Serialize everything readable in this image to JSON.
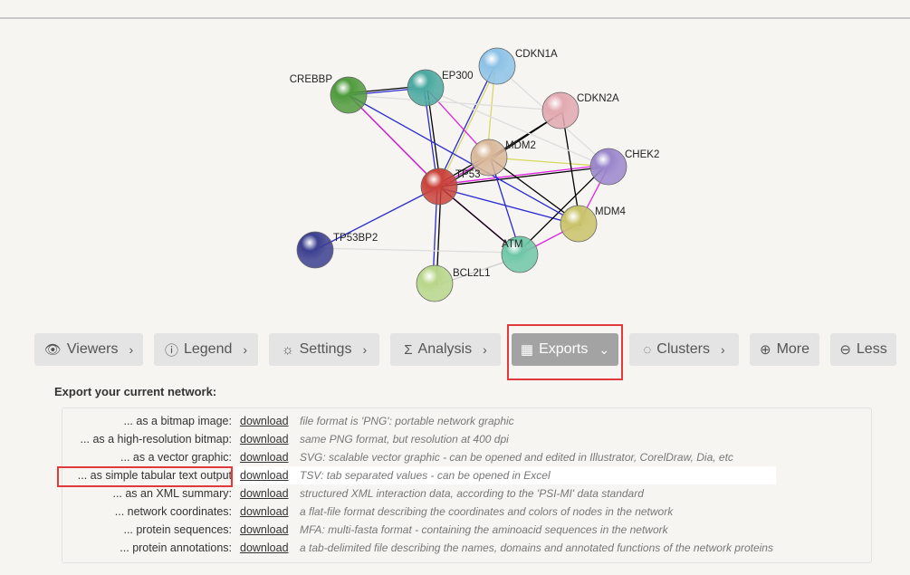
{
  "network": {
    "nodes": [
      {
        "id": "CREBBP",
        "color": "#4f9a3c"
      },
      {
        "id": "EP300",
        "color": "#4aa9a0"
      },
      {
        "id": "CDKN1A",
        "color": "#8cc2e6"
      },
      {
        "id": "CDKN2A",
        "color": "#e2a9b0"
      },
      {
        "id": "MDM2",
        "color": "#d9b89a"
      },
      {
        "id": "TP53",
        "color": "#c9423a"
      },
      {
        "id": "CHEK2",
        "color": "#9a86cc"
      },
      {
        "id": "MDM4",
        "color": "#c9c36a"
      },
      {
        "id": "ATM",
        "color": "#6fc7a8"
      },
      {
        "id": "BCL2L1",
        "color": "#b8d68a"
      },
      {
        "id": "TP53BP2",
        "color": "#3b3f8f"
      }
    ]
  },
  "toolbar": {
    "buttons": [
      {
        "label": "Viewers",
        "icon": "eye-icon",
        "glyph": "👁",
        "chev": "›"
      },
      {
        "label": "Legend",
        "icon": "info-icon",
        "glyph": "ⓘ",
        "chev": "›"
      },
      {
        "label": "Settings",
        "icon": "gear-icon",
        "glyph": "☼",
        "chev": "›"
      },
      {
        "label": "Analysis",
        "icon": "sigma-icon",
        "glyph": "Σ",
        "chev": "›"
      },
      {
        "label": "Exports",
        "icon": "table-icon",
        "glyph": "▦",
        "chev": "⌄"
      },
      {
        "label": "Clusters",
        "icon": "clusters-icon",
        "glyph": "◌",
        "chev": "›"
      },
      {
        "label": "More",
        "icon": "plus-circle-icon",
        "glyph": "⊕",
        "chev": ""
      },
      {
        "label": "Less",
        "icon": "minus-circle-icon",
        "glyph": "⊖",
        "chev": ""
      }
    ],
    "active": "Exports",
    "active_color": "#a3a3a3",
    "highlight_color": "#e03a3a"
  },
  "exports": {
    "heading": "Export your current network:",
    "link_label": "download",
    "rows": [
      {
        "label": "... as a bitmap image:",
        "desc": "file format is 'PNG': portable network graphic"
      },
      {
        "label": "... as a high-resolution bitmap:",
        "desc": "same PNG format, but resolution at 400 dpi"
      },
      {
        "label": "... as a vector graphic:",
        "desc": "SVG: scalable vector graphic - can be opened and edited in Illustrator, CorelDraw, Dia, etc"
      },
      {
        "label": "... as simple tabular text output",
        "desc": "TSV: tab separated values - can be opened in Excel"
      },
      {
        "label": "... as an XML summary:",
        "desc": "structured XML interaction data, according to the 'PSI-MI' data standard"
      },
      {
        "label": "... network coordinates:",
        "desc": "a flat-file format describing the coordinates and colors of nodes in the network"
      },
      {
        "label": "... protein sequences:",
        "desc": "MFA: multi-fasta format - containing the aminoacid sequences in the network"
      },
      {
        "label": "... protein annotations:",
        "desc": "a tab-delimited file describing the names, domains and annotated functions of the network proteins"
      }
    ]
  }
}
